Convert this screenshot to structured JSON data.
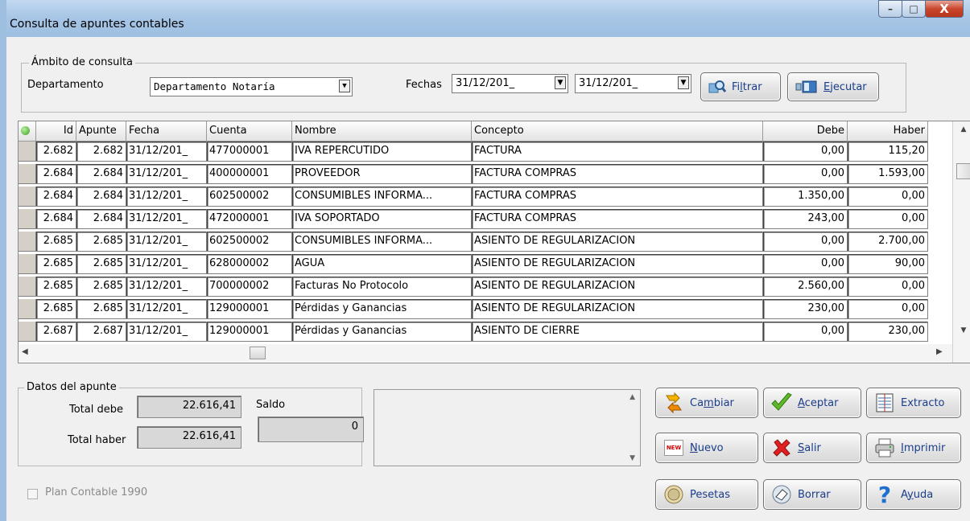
{
  "window": {
    "title": "Consulta de apuntes contables",
    "buttons": {
      "minimize": "–",
      "maximize": "□",
      "close": "X"
    }
  },
  "ambito": {
    "legend": "Ámbito de consulta",
    "departamento_label": "Departamento",
    "departamento_value": "Departamento Notaría",
    "fechas_label": "Fechas",
    "fecha_desde": "31/12/201_",
    "fecha_hasta": "31/12/201_",
    "filtrar": {
      "pre": "Fi",
      "hot": "l",
      "post": "trar"
    },
    "ejecutar": {
      "pre": "",
      "hot": "E",
      "post": "jecutar"
    }
  },
  "grid": {
    "columns": [
      "",
      "Id",
      "Apunte",
      "Fecha",
      "Cuenta",
      "Nombre",
      "Concepto",
      "Debe",
      "Haber"
    ],
    "rows": [
      [
        "2.682",
        "2.682",
        "31/12/201_",
        "477000001",
        "IVA REPERCUTIDO",
        "FACTURA",
        "0,00",
        "115,20"
      ],
      [
        "2.684",
        "2.684",
        "31/12/201_",
        "400000001",
        "PROVEEDOR",
        "FACTURA COMPRAS",
        "0,00",
        "1.593,00"
      ],
      [
        "2.684",
        "2.684",
        "31/12/201_",
        "602500002",
        "CONSUMIBLES INFORMA...",
        "FACTURA COMPRAS",
        "1.350,00",
        "0,00"
      ],
      [
        "2.684",
        "2.684",
        "31/12/201_",
        "472000001",
        "IVA SOPORTADO",
        "FACTURA COMPRAS",
        "243,00",
        "0,00"
      ],
      [
        "2.685",
        "2.685",
        "31/12/201_",
        "602500002",
        "CONSUMIBLES INFORMA...",
        "ASIENTO DE REGULARIZACION",
        "0,00",
        "2.700,00"
      ],
      [
        "2.685",
        "2.685",
        "31/12/201_",
        "628000002",
        "AGUA",
        "ASIENTO DE REGULARIZACION",
        "0,00",
        "90,00"
      ],
      [
        "2.685",
        "2.685",
        "31/12/201_",
        "700000002",
        "Facturas No Protocolo",
        "ASIENTO DE REGULARIZACION",
        "2.560,00",
        "0,00"
      ],
      [
        "2.685",
        "2.685",
        "31/12/201_",
        "129000001",
        "Pérdidas y Ganancias",
        "ASIENTO DE REGULARIZACION",
        "230,00",
        "0,00"
      ],
      [
        "2.687",
        "2.687",
        "31/12/201_",
        "129000001",
        "Pérdidas y Ganancias",
        "ASIENTO DE CIERRE",
        "0,00",
        "230,00"
      ]
    ]
  },
  "datos": {
    "legend": "Datos del apunte",
    "total_debe_label": "Total debe",
    "total_debe": "22.616,41",
    "total_haber_label": "Total haber",
    "total_haber": "22.616,41",
    "saldo_label": "Saldo",
    "saldo": "0"
  },
  "buttons": {
    "cambiar": {
      "pre": "Ca",
      "hot": "m",
      "post": "biar"
    },
    "aceptar": {
      "pre": "",
      "hot": "A",
      "post": "ceptar"
    },
    "extracto": {
      "pre": "",
      "hot": "",
      "post": "Extracto"
    },
    "nuevo": {
      "pre": "",
      "hot": "N",
      "post": "uevo"
    },
    "salir": {
      "pre": "",
      "hot": "S",
      "post": "alir"
    },
    "imprimir": {
      "pre": "",
      "hot": "I",
      "post": "mprimir"
    },
    "pesetas": {
      "pre": "",
      "hot": "",
      "post": "Pesetas"
    },
    "borrar": {
      "pre": "",
      "hot": "",
      "post": "Borrar"
    },
    "ayuda": {
      "pre": "A",
      "hot": "y",
      "post": "uda"
    },
    "new_badge": "NEW"
  },
  "plan_contable": {
    "label": "Plan Contable 1990",
    "checked": false
  },
  "colors": {
    "titlebar": "#a8c6e6",
    "close": "#c9462c",
    "grid_border": "#808080"
  }
}
